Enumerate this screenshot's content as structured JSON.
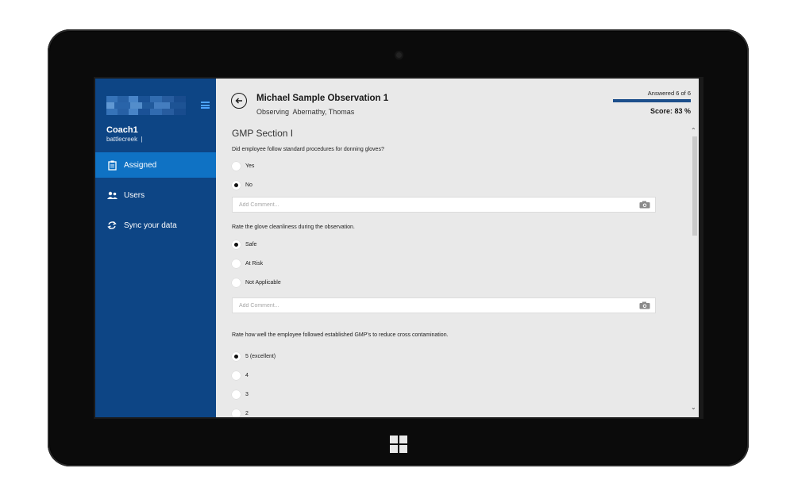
{
  "sidebar": {
    "user_name": "Coach1",
    "user_org": "battlecreek",
    "items": [
      {
        "label": "Assigned",
        "icon": "clipboard-icon",
        "active": true
      },
      {
        "label": "Users",
        "icon": "users-icon",
        "active": false
      },
      {
        "label": "Sync your data",
        "icon": "sync-icon",
        "active": false
      }
    ]
  },
  "header": {
    "title": "Michael Sample Observation 1",
    "observing_label": "Observing",
    "observing_name": "Abernathy, Thomas",
    "answered_text": "Answered  6  of  6",
    "progress": 1.0,
    "score_text": "Score:  83 %"
  },
  "section": {
    "title": "GMP Section I",
    "questions": [
      {
        "text": "Did employee follow standard procedures for donning gloves?",
        "options": [
          "Yes",
          "No"
        ],
        "selected": 1,
        "comment_placeholder": "Add Comment..."
      },
      {
        "text": "Rate the glove cleanliness during the observation.",
        "options": [
          "Safe",
          "At Risk",
          "Not Applicable"
        ],
        "selected": 0,
        "comment_placeholder": "Add Comment..."
      },
      {
        "text": "Rate how well the employee followed established GMP's to reduce cross contamination.",
        "options": [
          "5 (excellent)",
          "4",
          "3",
          "2"
        ],
        "selected": 0
      }
    ]
  },
  "colors": {
    "sidebar": "#0d4585",
    "sidebar_active": "#0f72c4",
    "content_bg": "#e9e9e9",
    "progress": "#1c4f8b"
  }
}
